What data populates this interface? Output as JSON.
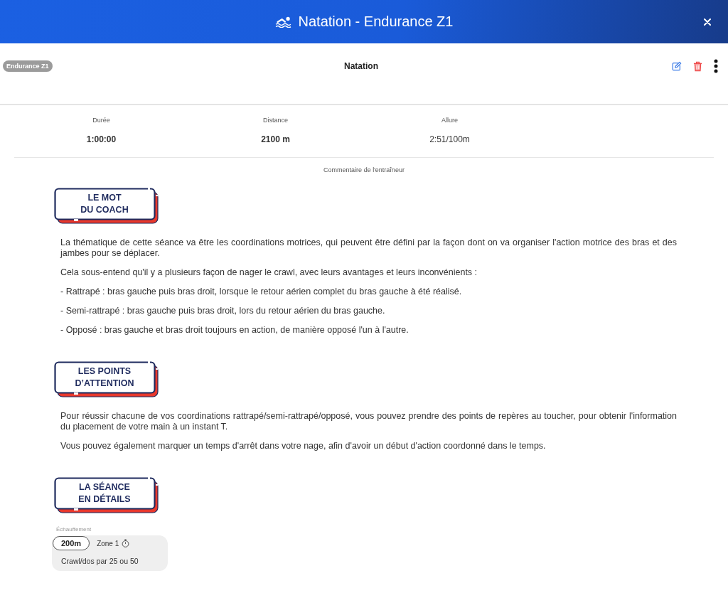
{
  "window": {
    "title": "Natation - Endurance Z1"
  },
  "session": {
    "tag": "Endurance Z1",
    "sport": "Natation"
  },
  "stats": [
    {
      "label": "Durée",
      "value": "1:00:00",
      "bold": true
    },
    {
      "label": "Distance",
      "value": "2100 m",
      "bold": true
    },
    {
      "label": "Allure",
      "value": "2:51/100m",
      "bold": false
    }
  ],
  "comment_label": "Commentaire de l'entraîneur",
  "sections": [
    {
      "heading": "LE MOT\nDU COACH",
      "paragraphs": [
        "La thématique de cette séance va être les coordinations motrices, qui peuvent être défini par la façon dont on va organiser l'action motrice des bras et des jambes pour se déplacer.",
        "Cela sous-entend qu'il y a plusieurs façon de nager le crawl, avec leurs avantages et leurs inconvénients :",
        "- Rattrapé : bras gauche puis bras droit, lorsque le retour aérien complet du bras gauche à été réalisé.",
        "- Semi-rattrapé : bras gauche puis bras droit, lors du retour aérien du bras gauche.",
        "- Opposé : bras gauche et bras droit toujours en action, de manière opposé l'un à l'autre."
      ]
    },
    {
      "heading": "LES POINTS\nD’ATTENTION",
      "paragraphs": [
        "Pour réussir chacune de vos coordinations rattrapé/semi-rattrapé/opposé, vous pouvez prendre des points de repères au toucher, pour obtenir l'information du placement de votre main à un instant T.",
        "Vous pouvez également marquer un temps d'arrêt dans votre nage, afin d'avoir un début d'action coordonné dans le temps."
      ]
    },
    {
      "heading": "LA SÉANCE\nEN DÉTAILS",
      "blocks": [
        {
          "label": "Échauffement",
          "distance": "200m",
          "zone": "Zone 1",
          "description": "Crawl/dos par 25 ou 50"
        }
      ]
    }
  ]
}
